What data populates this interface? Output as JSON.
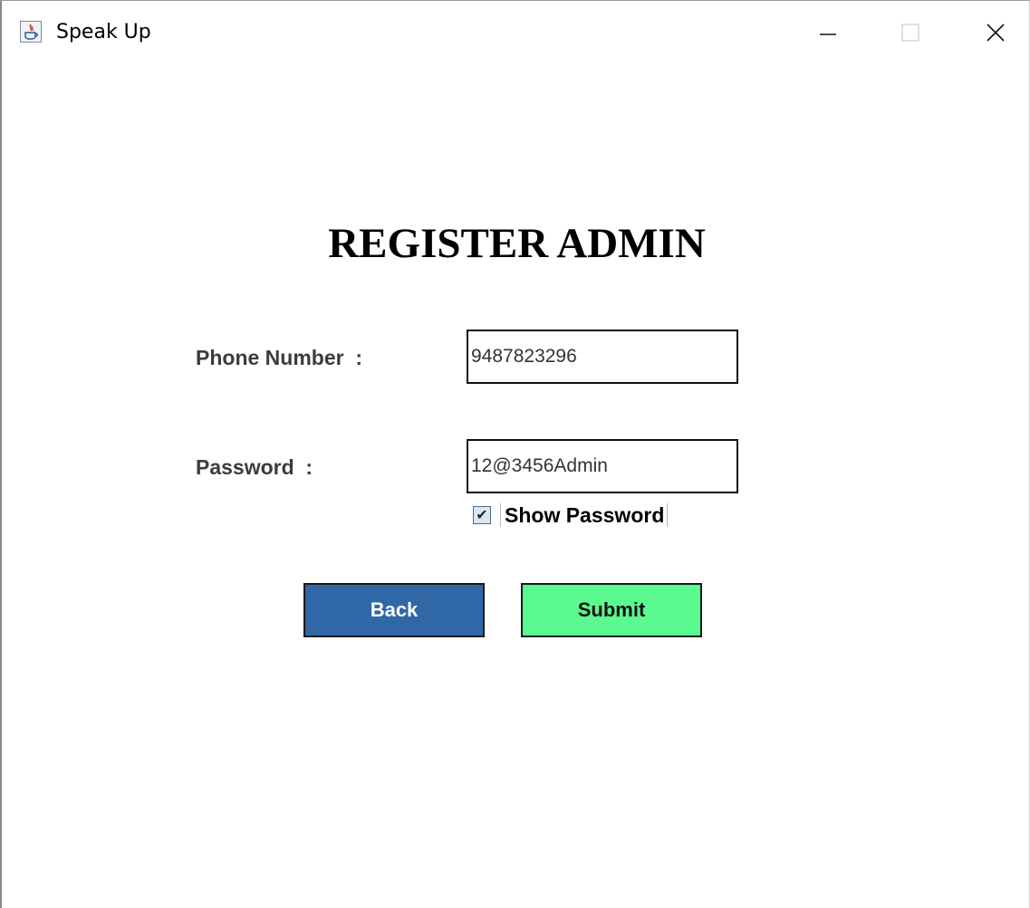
{
  "window": {
    "title": "Speak Up",
    "icon": "java-app-icon",
    "controls": {
      "minimize_icon": "minimize-icon",
      "maximize_icon": "maximize-icon",
      "close_icon": "close-icon"
    }
  },
  "form": {
    "heading": "REGISTER ADMIN",
    "phone_label": "Phone Number  :",
    "phone_value": "9487823296",
    "password_label": "Password  :",
    "password_value": "12@3456Admin",
    "show_password_label": "Show Password",
    "show_password_checked": true
  },
  "buttons": {
    "back_label": "Back",
    "submit_label": "Submit"
  },
  "colors": {
    "back_button": "#2f67a7",
    "submit_button": "#5afa90"
  }
}
